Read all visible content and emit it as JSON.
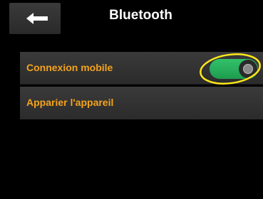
{
  "header": {
    "title": "Bluetooth",
    "back_icon": "left-arrow-icon"
  },
  "settings": {
    "rows": [
      {
        "label": "Connexion mobile",
        "toggle_on": true
      },
      {
        "label": "Apparier l'appareil"
      }
    ]
  },
  "colors": {
    "accent_label": "#f4a31c",
    "toggle_on": "#2ab85d",
    "highlight": "#ffe81a"
  }
}
